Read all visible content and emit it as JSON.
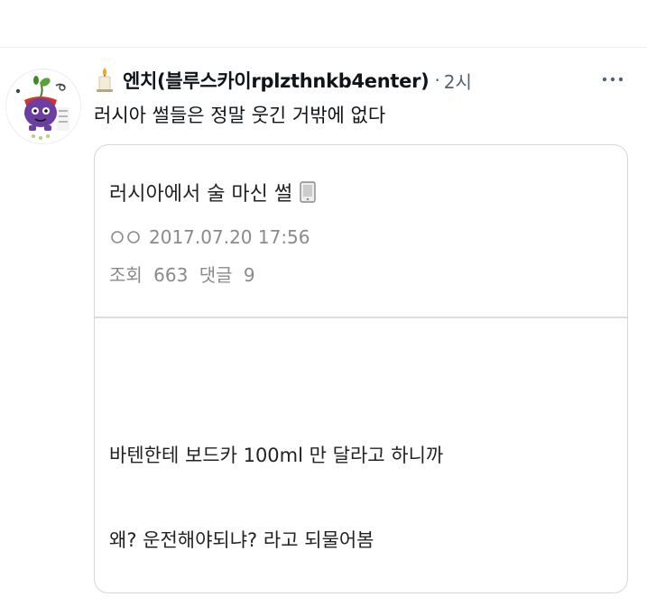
{
  "tweet": {
    "display_name": "엔치(블루스카이rplzthnkb4enter)",
    "separator": "·",
    "time": "2시",
    "text": "러시아 썰들은 정말 웃긴 거밖에 없다",
    "avatar_icon": "purple-cartoon-avatar",
    "name_icon": "candle-icon",
    "more_icon": "more-dots-icon"
  },
  "card": {
    "title": "러시아에서 술 마신 썰",
    "title_icon": "phone-icon",
    "author_icon": "circles-icon",
    "date": "2017.07.20 17:56",
    "views_label": "조회",
    "views_count": "663",
    "comments_label": "댓글",
    "comments_count": "9",
    "body_lines": [
      "바텐한테 보드카 100ml 만 달라고 하니까",
      "왜? 운전해야되냐? 라고 되물어봄"
    ]
  },
  "colors": {
    "text_primary": "#0f1419",
    "text_secondary": "#536471",
    "card_border": "#cfd9de",
    "card_meta": "#8a8a8a",
    "avatar_purple": "#6b3fa0",
    "avatar_red": "#d9322b"
  }
}
